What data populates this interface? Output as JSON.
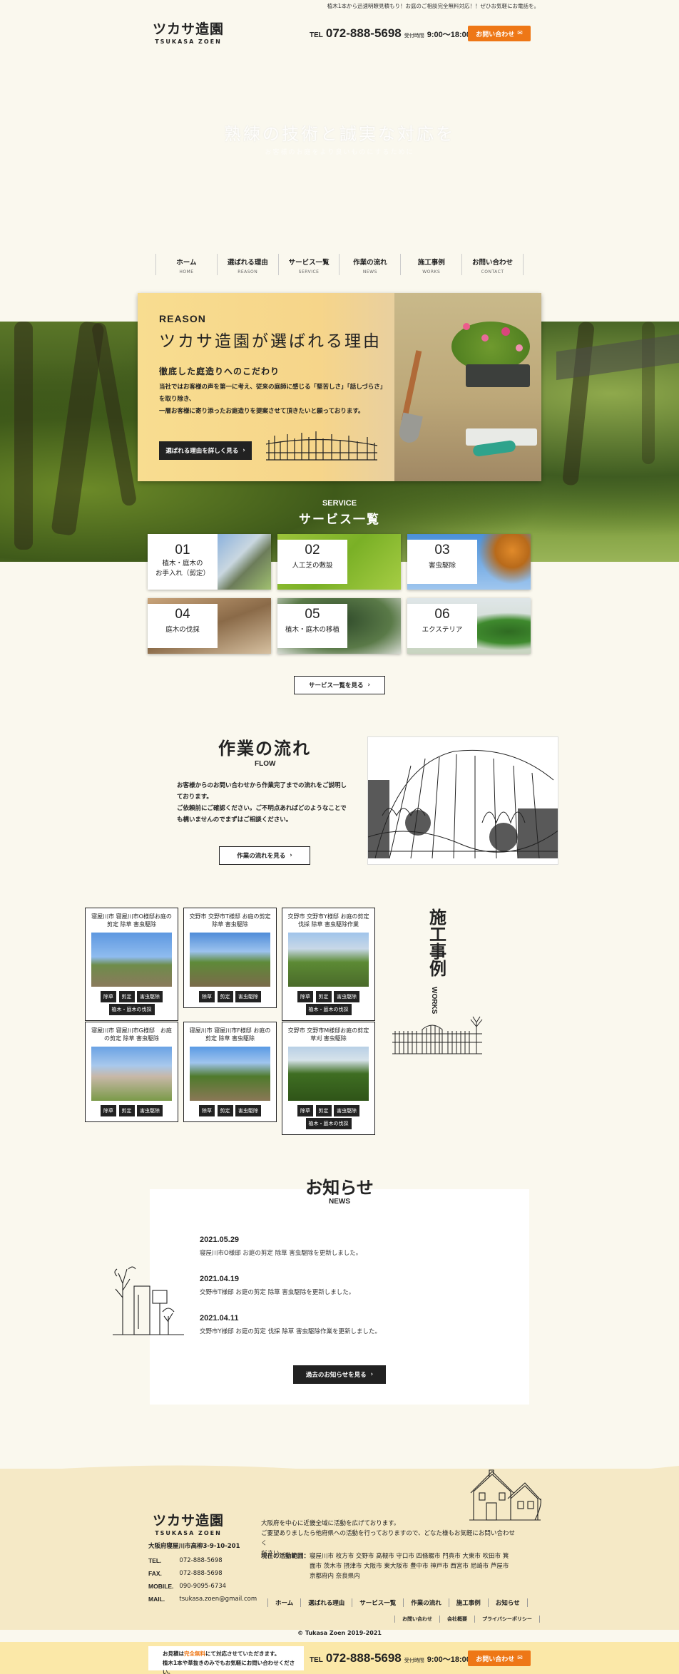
{
  "topbar": {
    "text": "植木1本から迅速明瞭見積もり！お庭のご相談完全無料対応！！ぜひお気軽にお電話を。"
  },
  "header": {
    "logo_jp": "ツカサ造園",
    "logo_en": "TSUKASA ZOEN",
    "tel_prefix": "TEL",
    "tel": "072-888-5698",
    "hours_label": "受付時間",
    "hours": "9:00～18:00",
    "contact_btn": "お問い合わせ"
  },
  "hero": {
    "title": "熟練の技術と誠実な対応を",
    "subtitle": "お客様のお庭をより良いものにするために"
  },
  "nav": [
    {
      "jp": "ホーム",
      "en": "HOME"
    },
    {
      "jp": "選ばれる理由",
      "en": "REASON"
    },
    {
      "jp": "サービス一覧",
      "en": "SERVICE"
    },
    {
      "jp": "作業の流れ",
      "en": "NEWS"
    },
    {
      "jp": "施工事例",
      "en": "WORKS"
    },
    {
      "jp": "お問い合わせ",
      "en": "CONTACT"
    }
  ],
  "reason": {
    "label": "REASON",
    "title": "ツカサ造園が選ばれる理由",
    "subtitle": "徹底した庭造りへのこだわり",
    "line1": "当社ではお客様の声を第一に考え、従来の庭師に感じる「堅苦しさ」「話しづらさ」",
    "line2": "を取り除き、",
    "line3": "一層お客様に寄り添ったお庭造りを提案させて頂きたいと願っております。",
    "button": "選ばれる理由を詳しく見る"
  },
  "service": {
    "label_en": "SERVICE",
    "label_jp": "サービス一覧",
    "items": [
      {
        "num": "01",
        "name1": "植木・庭木の",
        "name2": "お手入れ（剪定）"
      },
      {
        "num": "02",
        "name1": "人工芝の敷設",
        "name2": ""
      },
      {
        "num": "03",
        "name1": "害虫駆除",
        "name2": ""
      },
      {
        "num": "04",
        "name1": "庭木の伐採",
        "name2": ""
      },
      {
        "num": "05",
        "name1": "植木・庭木の移植",
        "name2": ""
      },
      {
        "num": "06",
        "name1": "エクステリア",
        "name2": ""
      }
    ],
    "button": "サービス一覧を見る"
  },
  "flow": {
    "title": "作業の流れ",
    "en": "FLOW",
    "line1": "お客様からのお問い合わせから作業完了までの流れをご説明し",
    "line2": "ております。",
    "line3": "ご依頼前にご確認ください。ご不明点あればどのようなことで",
    "line4": "も構いませんのでまずはご相談ください。",
    "button": "作業の流れを見る"
  },
  "works": {
    "title": "施工事例",
    "en": "WORKS",
    "items": [
      {
        "title": "寝屋川市 寝屋川市O様邸お庭の剪定 除草 害虫駆除",
        "tags": [
          "除草",
          "剪定",
          "害虫駆除",
          "植木・庭木の伐採"
        ]
      },
      {
        "title": "交野市 交野市T様邸 お庭の剪定 除草 害虫駆除",
        "tags": [
          "除草",
          "剪定",
          "害虫駆除"
        ]
      },
      {
        "title": "交野市 交野市Y様邸 お庭の剪定 伐採 除草 害虫駆除作業",
        "tags": [
          "除草",
          "剪定",
          "害虫駆除",
          "植木・庭木の伐採"
        ]
      },
      {
        "title": "寝屋川市 寝屋川市G様邸　お庭の剪定 除草 害虫駆除",
        "tags": [
          "除草",
          "剪定",
          "害虫駆除"
        ]
      },
      {
        "title": "寝屋川市 寝屋川市F様邸 お庭の剪定 除草 害虫駆除",
        "tags": [
          "除草",
          "剪定",
          "害虫駆除"
        ]
      },
      {
        "title": "交野市 交野市M様邸お庭の剪定 草刈 害虫駆除",
        "tags": [
          "除草",
          "剪定",
          "害虫駆除",
          "植木・庭木の伐採"
        ]
      }
    ]
  },
  "news": {
    "title": "お知らせ",
    "en": "NEWS",
    "items": [
      {
        "date": "2021.05.29",
        "text": "寝屋川市O様邸 お庭の剪定 除草 害虫駆除を更新しました。"
      },
      {
        "date": "2021.04.19",
        "text": "交野市T様邸 お庭の剪定 除草 害虫駆除を更新しました。"
      },
      {
        "date": "2021.04.11",
        "text": "交野市Y様邸 お庭の剪定 伐採 除草 害虫駆除作業を更新しました。"
      }
    ],
    "button": "過去のお知らせを見る"
  },
  "footer": {
    "logo_jp": "ツカサ造園",
    "logo_en": "TSUKASA ZOEN",
    "address": "大阪府寝屋川市高柳3-9-10-201",
    "tel_label": "TEL.",
    "tel": "072-888-5698",
    "fax_label": "FAX.",
    "fax": "072-888-5698",
    "mobile_label": "MOBILE.",
    "mobile": "090-9095-6734",
    "mail_label": "MAIL.",
    "mail": "tsukasa.zoen@gmail.com",
    "desc1": "大阪府を中心に近畿全域に活動を広げております。",
    "desc2": "ご要望ありましたら他府県への活動を行っておりますので、どなた様もお気軽にお問い合わせく",
    "desc3": "ださい。",
    "area_label": "現在の活動範囲：",
    "area1": "寝屋川市 枚方市 交野市 高槻市 守口市 四條畷市 門真市 大東市 吹田市 箕",
    "area2": "面市 茨木市 摂津市 大阪市 東大阪市 豊中市 神戸市 西宮市 尼崎市 芦屋市",
    "area3": "京都府内 奈良県内",
    "nav": [
      "ホーム",
      "選ばれる理由",
      "サービス一覧",
      "作業の流れ",
      "施工事例",
      "お知らせ"
    ],
    "nav2": [
      "お問い合わせ",
      "会社概要",
      "プライバシーポリシー"
    ],
    "copyright": "© Tukasa Zoen 2019-2021"
  },
  "bottombar": {
    "line1a": "お見積は",
    "line1b": "完全無料",
    "line1c": "にて対応させていただきます。",
    "line2": "植木1本や草抜きのみでもお気軽にお問い合わせください。",
    "tel_prefix": "TEL",
    "tel": "072-888-5698",
    "hours_label": "受付時間",
    "hours": "9:00～18:00",
    "contact_btn": "お問い合わせ"
  },
  "colors": {
    "accent": "#ee7716",
    "bg": "#faf8ee",
    "dark": "#222222"
  }
}
